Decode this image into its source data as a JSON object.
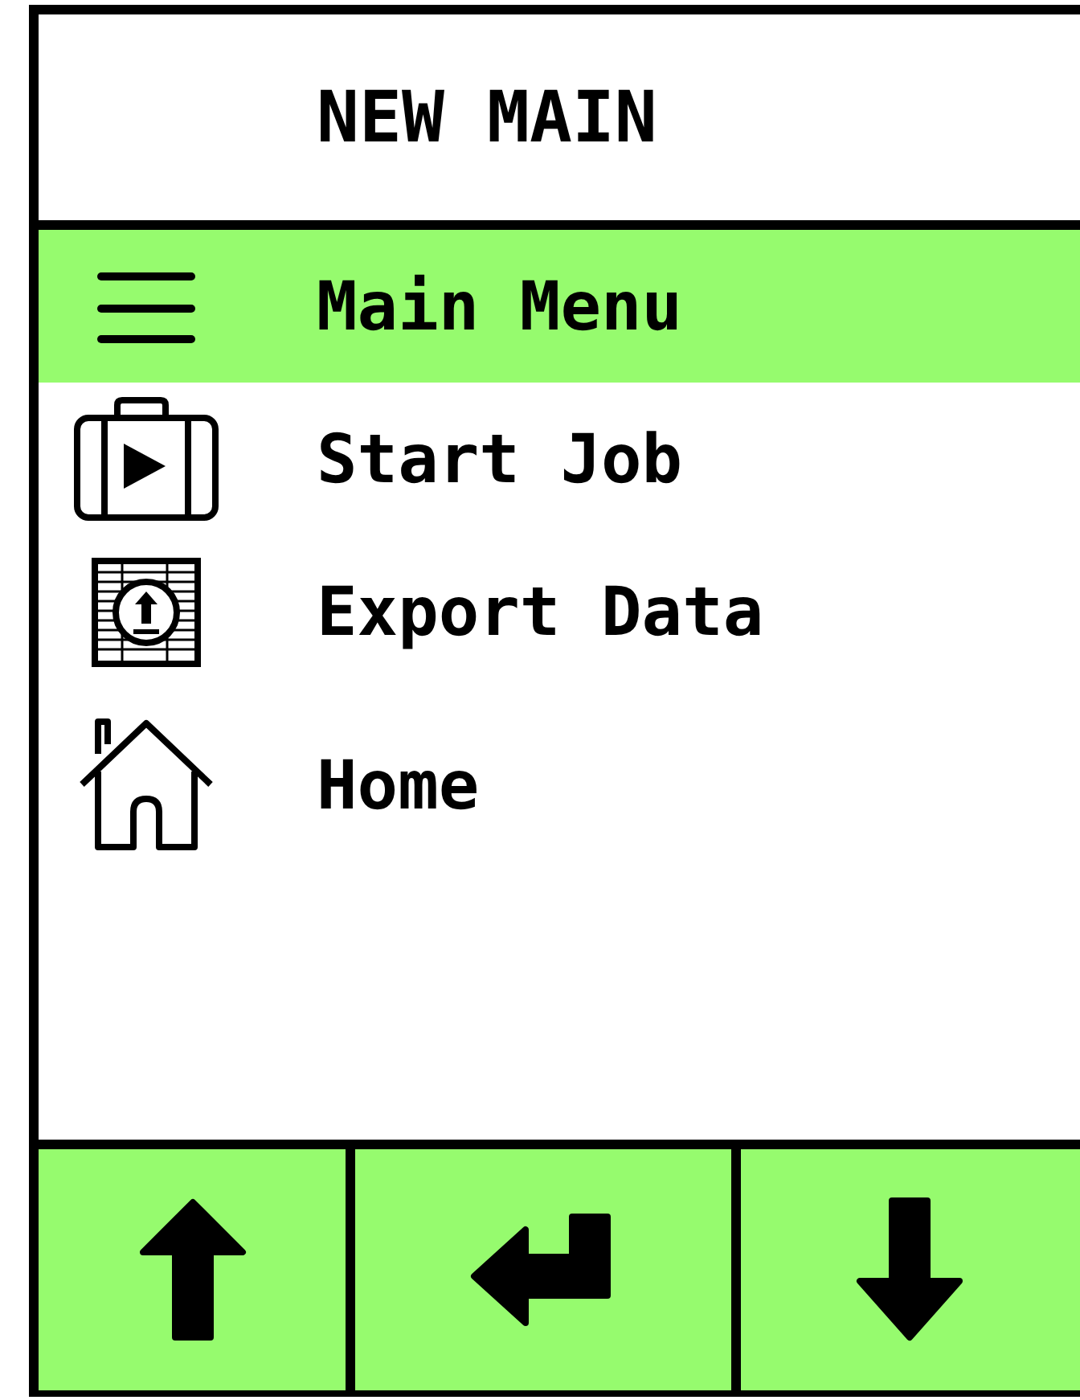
{
  "header": {
    "title": "NEW MAIN"
  },
  "menu": [
    {
      "label": "Main Menu",
      "kind": "menu",
      "selected": true
    },
    {
      "label": "Start Job",
      "kind": "job",
      "selected": false
    },
    {
      "label": "Export Data",
      "kind": "export",
      "selected": false
    },
    {
      "label": "Home",
      "kind": "home",
      "selected": false
    }
  ],
  "buttons": [
    {
      "kind": "up"
    },
    {
      "kind": "enter"
    },
    {
      "kind": "down"
    }
  ]
}
